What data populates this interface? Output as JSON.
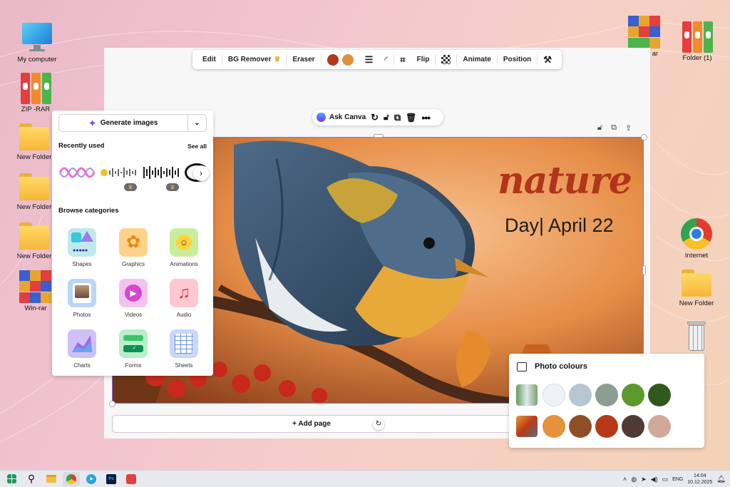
{
  "desktop_left": [
    {
      "label": "My computer",
      "icon": "monitor-icon"
    },
    {
      "label": "ZIP -RAR",
      "icon": "binders-icon"
    },
    {
      "label": "New Folder",
      "icon": "folder-icon"
    },
    {
      "label": "New Folder",
      "icon": "folder-icon"
    },
    {
      "label": "New Folder",
      "icon": "folder-icon"
    },
    {
      "label": "Win-rar",
      "icon": "winrar-icon"
    }
  ],
  "desktop_right": [
    {
      "label": "ar",
      "icon": "winrar-icon"
    },
    {
      "label": "Folder (1)",
      "icon": "binders-icon"
    },
    {
      "label": "Internet",
      "icon": "chrome-icon"
    },
    {
      "label": "New Folder",
      "icon": "folder-icon"
    },
    {
      "label": "",
      "icon": "recycle-bin-icon"
    }
  ],
  "toolbar": {
    "edit": "Edit",
    "bg_remover": "BG Remover",
    "eraser": "Eraser",
    "flip": "Flip",
    "animate": "Animate",
    "position": "Position",
    "colors": [
      "#b5361b",
      "#e0913a"
    ]
  },
  "ask_canva": "Ask Canva",
  "design": {
    "title": "nature",
    "subtitle": "Day| April 22"
  },
  "add_page": "+ Add page",
  "panel": {
    "generate": "Generate images",
    "recently_used": "Recently used",
    "see_all": "See all",
    "browse": "Browse categories",
    "categories": [
      {
        "label": "Shapes",
        "color": "#bfe9ef"
      },
      {
        "label": "Graphics",
        "color": "#ffd28a"
      },
      {
        "label": "Animations",
        "color": "#c8ee9b"
      },
      {
        "label": "Photos",
        "color": "#bad5f6"
      },
      {
        "label": "Videos",
        "color": "#f3c3f0"
      },
      {
        "label": "Audio",
        "color": "#ffc7cf"
      },
      {
        "label": "Charts",
        "color": "#cfc0f5"
      },
      {
        "label": "Forms",
        "color": "#b7efc9"
      },
      {
        "label": "Sheets",
        "color": "#c8d8f7"
      }
    ]
  },
  "photo_colours": {
    "title": "Photo colours",
    "row1": [
      "#eef3f8",
      "#b6c6d3",
      "#8c9e92",
      "#5c9a2e",
      "#2f5a1b"
    ],
    "row2": [
      "#e6913b",
      "#8e4f27",
      "#b63a17",
      "#4f3a34",
      "#d2a898"
    ]
  },
  "taskbar": {
    "lang": "ENG",
    "time": "14:04",
    "date": "10.12.2025"
  }
}
